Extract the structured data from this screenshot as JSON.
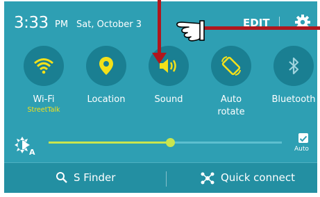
{
  "status_bar": {
    "time": "3:33",
    "ampm": "PM",
    "date": "Sat, October 3",
    "edit_label": "EDIT",
    "settings_icon": "gear-icon"
  },
  "quick_toggles": [
    {
      "label": "Wi-Fi",
      "sublabel": "StreetTalk",
      "icon": "wifi-icon",
      "active": true
    },
    {
      "label": "Location",
      "sublabel": "",
      "icon": "location-pin-icon",
      "active": true
    },
    {
      "label": "Sound",
      "sublabel": "",
      "icon": "speaker-icon",
      "active": true
    },
    {
      "label": "Auto",
      "label2": "rotate",
      "sublabel": "",
      "icon": "auto-rotate-icon",
      "active": true
    },
    {
      "label": "Bluetooth",
      "sublabel": "",
      "icon": "bluetooth-icon",
      "active": false
    }
  ],
  "brightness": {
    "level": 0.52,
    "auto_label": "Auto",
    "auto_checked": true
  },
  "bottom_bar": {
    "s_finder_label": "S Finder",
    "quick_connect_label": "Quick connect"
  },
  "colors": {
    "panel_bg": "#2e9fb3",
    "tile_bg": "#1a7f92",
    "active_icon": "#f3e11a",
    "slider_fill": "#c9e54e",
    "annotation_red": "#b0161d"
  }
}
